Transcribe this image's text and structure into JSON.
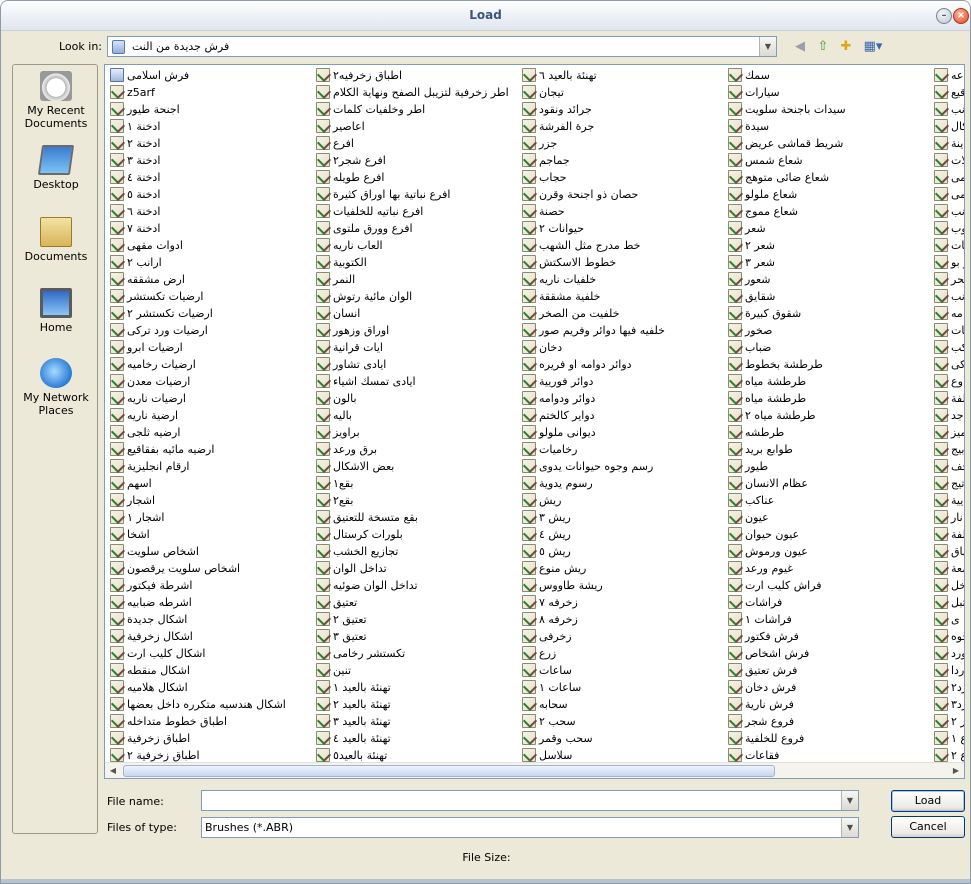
{
  "window": {
    "title": "Load"
  },
  "lookin": {
    "label": "Look in:",
    "value": "فرش جديدة من النت"
  },
  "places": [
    "My Recent Documents",
    "Desktop",
    "Documents",
    "Home",
    "My Network Places"
  ],
  "columns": [
    [
      "فرش اسلامى",
      "z5arf",
      "اجنحة طيور",
      "ادخنة ١",
      "ادخنة ٢",
      "ادخنة ٣",
      "ادخنة ٤",
      "ادخنة ٥",
      "ادخنة ٦",
      "ادخنة ٧",
      "ادوات مقهى",
      "ارانب ٢",
      "ارض مشققه",
      "ارضيات تكستشر",
      "ارضيات تكستشر ٢",
      "ارضيات ورد تركى",
      "ارضيات ابرو",
      "ارضيات رخاميه",
      "ارضيات معدن",
      "ارضيات ناريه",
      "ارضية ناريه",
      "ارضيه ثلجى",
      "ارضيه مائيه بفقاقيع",
      "ارقام انجليزية",
      "اسهم",
      "اشجار",
      "اشجار ١",
      "اشخا",
      "اشخاص سلويت",
      "اشخاص سلويت يرقصون",
      "اشرطة فيكتور",
      "اشرطه ضبابيه",
      "اشكال جديدة",
      "اشكال زخرفية",
      "اشكال كليب ارت",
      "اشكال منقطه",
      "اشكال هلاميه",
      "اشكال هندسيه متكرره داخل بعضها",
      "اطباق خطوط متداخله",
      "اطباق زخرفية",
      "اطباق زخرفية ٢"
    ],
    [
      "اطباق زخرفيه٢",
      "اطر زخرفية لتزيبل الصفح ونهاية الكلام",
      "اطر وخلفيات كلمات",
      "اعاصير",
      "افرع",
      "افرع شجر٢",
      "افرع طويله",
      "افرع نباتية بها اوراق كثيرة",
      "افرع نباتيه للخلفيات",
      "افرع وورق ملتوى",
      "العاب ناريه",
      "الكتوبية",
      "النمر",
      "الوان مائية رتوش",
      "انسان",
      "اوراق وزهور",
      "ايات قرانية",
      "ايادى تشاور",
      "ايادى تمسك اشياء",
      "بالون",
      "باليه",
      "براويز",
      "برق ورعد",
      "بعض الاشكال",
      "بقع١",
      "بقع٢",
      "بقع متسخة للتعتيق",
      "بلورات كرستال",
      "تجازيع الخشب",
      "تداخل الوان",
      "تداخل الوان ضوئيه",
      "تعتيق",
      "تعتيق ٢",
      "تعتيق ٣",
      "تكستشر رخامى",
      "تنين",
      "تهنئة بالعيد ١",
      "تهنئة بالعيد ٢",
      "تهنئة بالعيد ٣",
      "تهنئة بالعيد ٤",
      "تهنئة بالعيد٥"
    ],
    [
      "تهنئة بالعيد ٦",
      "تيجان",
      "جرائد ونقود",
      "جرة الفرشة",
      "جزر",
      "جماجم",
      "حجاب",
      "حصان ذو اجنحة وقرن",
      "حصنة",
      "حيوانات ٢",
      "خط مدرج مثل الشهب",
      "خطوط الاسكتش",
      "خلفيات ناريه",
      "خلفية مشققة",
      "خلفيت من الصخر",
      "خلفيه فيها دوائر وفريم صور",
      "دخان",
      "دوائر دوامه او فريره",
      "دوائر فوريية",
      "دوائر ودوامه",
      "دواير كالختم",
      "ديوانى ملولو",
      "رخاميات",
      "رسم وجوه حيوانات يدوى",
      "رسوم يدوية",
      "ريش",
      "ريش ٣",
      "ريش ٤",
      "ريش ٥",
      "ريش منوع",
      "ريشة طاووس",
      "زخرفه ٧",
      "زخرفه ٨",
      "زخرفى",
      "زرع",
      "ساعات",
      "ساعات ١",
      "سحابه",
      "سحب ٢",
      "سحب وقمر",
      "سلاسل"
    ],
    [
      "سمك",
      "سيارات",
      "سيدات باجنحة سلويت",
      "سيدة",
      "شريط قماشى عريض",
      "شعاع شمس",
      "شعاع ضائى متوهج",
      "شعاع ملولو",
      "شعاع مموج",
      "شعر",
      "شعر ٢",
      "شعر ٣",
      "شعور",
      "شقايق",
      "شقوق كبيرة",
      "صخور",
      "ضباب",
      "طرطشة بخطوط",
      "طرطشة مياه",
      "طرطشة مياه",
      "طرطشة مياه ٢",
      "طرطشه",
      "طوابع بريد",
      "طيور",
      "عظام الانسان",
      "عناكب",
      "عيون",
      "عيون حيوان",
      "عيون ورموش",
      "غيوم ورعد",
      "فراش كليب ارت",
      "فراشات",
      "فراشات ١",
      "فرش فكتور",
      "فرش اشخاص",
      "فرش تعتيق",
      "فرش دخان",
      "فرش نارية",
      "فروع شجر",
      "فروع للخلفية",
      "فقاعات"
    ],
    [
      "اعه",
      "قيع",
      "انب",
      "كال",
      "ينة",
      "لات",
      "لمى",
      "مى",
      "انب",
      "وب",
      "يات",
      "ر بو",
      "بحر",
      "نب",
      "مه",
      "يات",
      "كب",
      "كى",
      "وع",
      "لفة",
      "اجد",
      "ميز",
      "بيج",
      "حف",
      "تيج",
      "يية",
      "نار",
      "لفة",
      "باق",
      "معة",
      "خل",
      "تبل",
      "ى",
      "جوه",
      "ورد",
      "ردا",
      "رد٢",
      "رد٣",
      "ر ٢",
      "ع ١",
      "ع ٢"
    ]
  ],
  "filename": {
    "label": "File name:",
    "value": ""
  },
  "filetype": {
    "label": "Files of type:",
    "value": "Brushes (*.ABR)"
  },
  "buttons": {
    "load": "Load",
    "cancel": "Cancel"
  },
  "filesize": {
    "label": "File Size:"
  },
  "icons": {
    "back": "back-arrow-icon",
    "up": "up-folder-icon",
    "new": "new-folder-icon",
    "views": "views-menu-icon"
  }
}
